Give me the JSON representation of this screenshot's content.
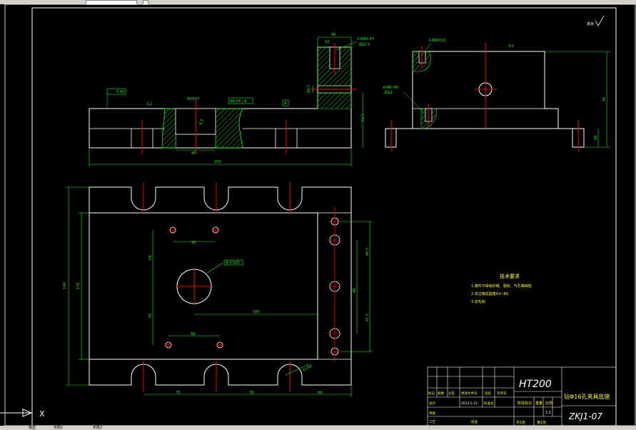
{
  "window": {
    "model_tab": "模型",
    "layout1_tab": "布局1",
    "layout2_tab": "布局2"
  },
  "ucs": {
    "x_label": "X"
  },
  "colors": {
    "background": "#000000",
    "outline": "#ffffff",
    "dimension": "#00ff00",
    "center_line": "#ff0000",
    "hatch": "#00ff00",
    "note_text": "#ffff00",
    "annotation": "#ffffff"
  },
  "front_view": {
    "dim_top_width": "90",
    "dim_small": "12",
    "dim_hole_note": "2-Φ10-7H",
    "dim_depth_note": "深12.5",
    "dim_overall_length": "250",
    "dim_base_width": "40",
    "dim_height": "52.5",
    "dim_step": "10.5",
    "flatness_tol": "0.02",
    "position_tol": "Φ0.04 | A",
    "roughness_1": "3.2",
    "roughness_2": "6.3",
    "datum_label": "A",
    "dim_bore": "Φ20H7"
  },
  "side_view": {
    "counterbore_note": "2-Φ10沉孔",
    "hole_note": "4-M6-7H",
    "depth_note": "深12",
    "dim_height": "35",
    "dim_lower": "18",
    "roughness": "3.2"
  },
  "top_view": {
    "dim_140": "140",
    "dim_145": "145",
    "dim_40": "40",
    "dim_50": "50",
    "dim_54": "54",
    "dim_55": "55",
    "dim_180": "180",
    "dim_70a": "70",
    "dim_70b": "70",
    "dim_60": "60",
    "dim_r_right_1": "60.5",
    "dim_r_right_2": "48",
    "dim_r_right_3": "61.5",
    "tol_box": "Φ 0.025",
    "radius_note": "4×R8"
  },
  "tech_requirements": {
    "title": "技术要求",
    "item1": "1.铸件不得有砂眼、裂纹、气孔等缺陷",
    "item2": "2.未注铸造圆角R3~R5",
    "item3": "3.去毛刺"
  },
  "corner_note": "其余",
  "title_block": {
    "material": "HT200",
    "part_name": "钻Φ16孔夹具底座",
    "drawing_no": "ZKJ1-07",
    "scale": "1:1",
    "stage_label": "阶段标记",
    "weight_label": "重量",
    "scale_label": "比例",
    "sheet_total": "共1张",
    "sheet_no": "第1张",
    "r1": [
      "标记",
      "处数",
      "分区",
      "更改文件号",
      "签名",
      "年月日"
    ],
    "designer": "设计",
    "date": "2013.5.15",
    "std_label": "标准化",
    "check_label": "审核",
    "process_label": "工艺",
    "approve_label": "批准"
  }
}
